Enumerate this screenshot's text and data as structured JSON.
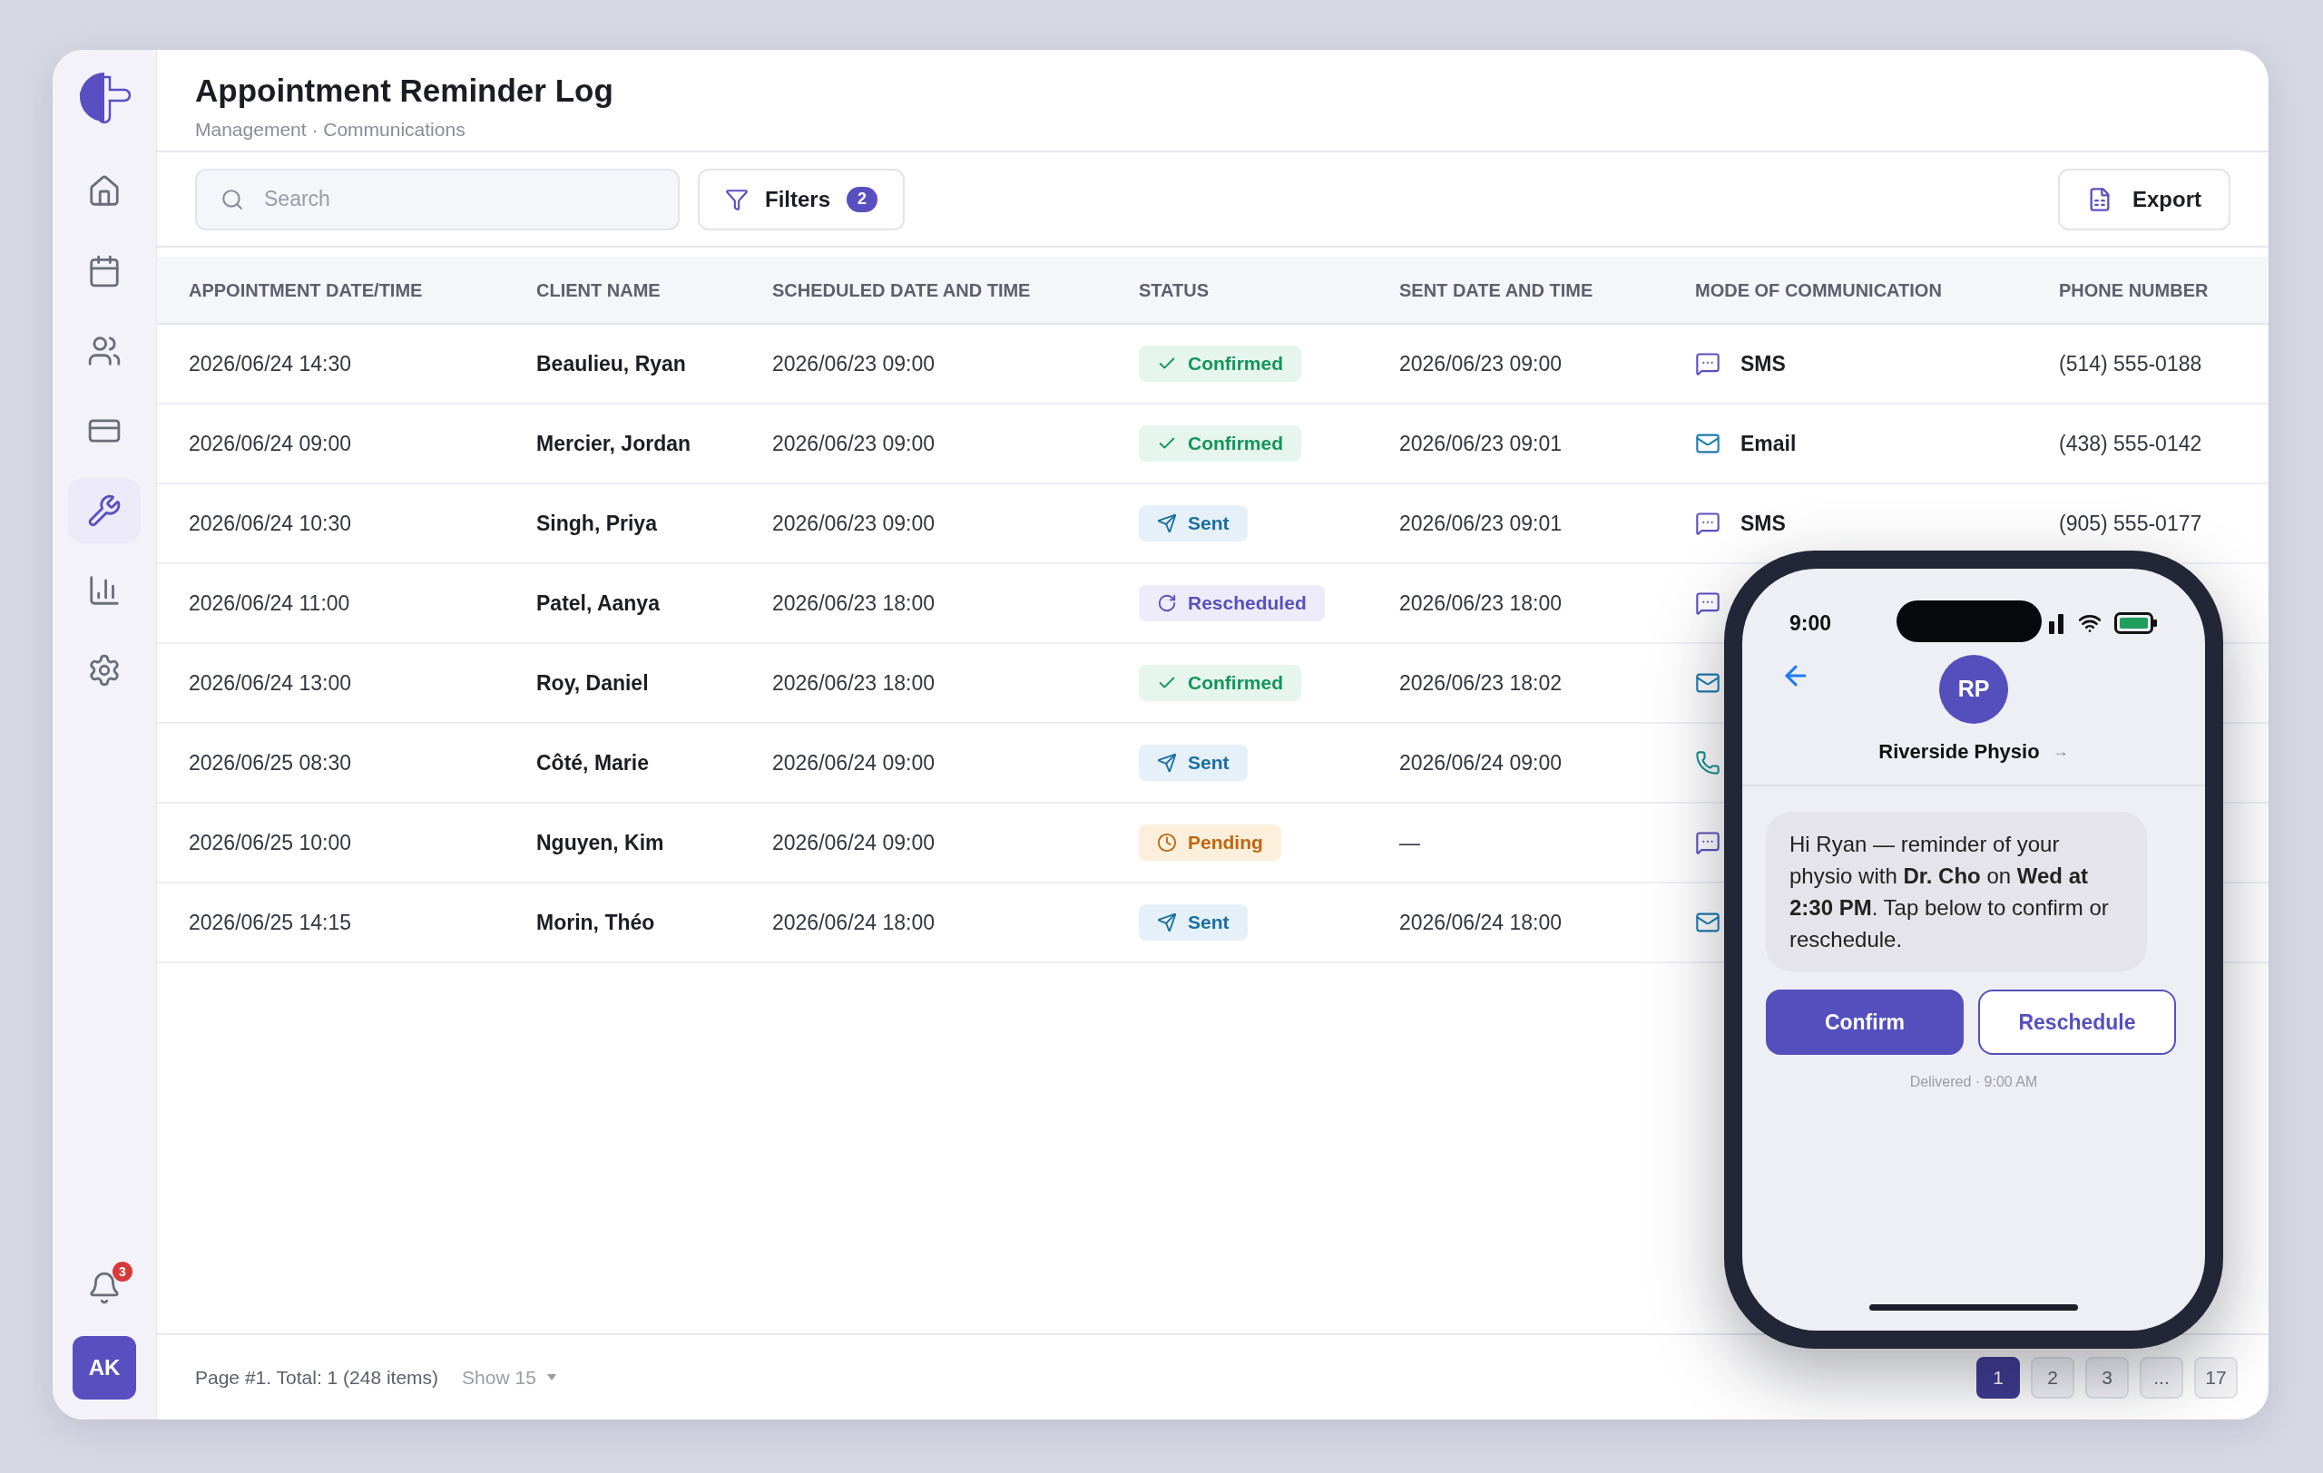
{
  "sidebar": {
    "items": [
      {
        "kind": "home",
        "selected": false
      },
      {
        "kind": "calendar",
        "selected": false
      },
      {
        "kind": "users",
        "selected": false
      },
      {
        "kind": "card",
        "selected": false
      },
      {
        "kind": "tools",
        "selected": true
      },
      {
        "kind": "chart",
        "selected": false
      },
      {
        "kind": "settings",
        "selected": false
      }
    ],
    "notifications": "3",
    "avatar": "AK"
  },
  "header": {
    "title": "Appointment Reminder Log",
    "breadcrumb": "Management · Communications"
  },
  "toolbar": {
    "search": {
      "placeholder": "Search"
    },
    "filters": {
      "label": "Filters",
      "count": "2"
    },
    "export": {
      "label": "Export"
    }
  },
  "table": {
    "columns": [
      "APPOINTMENT DATE/TIME",
      "CLIENT NAME",
      "SCHEDULED DATE AND TIME",
      "STATUS",
      "SENT DATE AND TIME",
      "MODE OF COMMUNICATION",
      "PHONE NUMBER"
    ],
    "rows": [
      {
        "appointment": "2026/06/24 14:30",
        "client": "Beaulieu, Ryan",
        "scheduled": "2026/06/23 09:00",
        "status": {
          "kind": "confirmed",
          "label": "Confirmed"
        },
        "sent": "2026/06/23 09:00",
        "mode": {
          "kind": "sms",
          "label": "SMS"
        },
        "phone": "(514) 555-0188"
      },
      {
        "appointment": "2026/06/24 09:00",
        "client": "Mercier, Jordan",
        "scheduled": "2026/06/23 09:00",
        "status": {
          "kind": "confirmed",
          "label": "Confirmed"
        },
        "sent": "2026/06/23 09:01",
        "mode": {
          "kind": "email",
          "label": "Email"
        },
        "phone": "(438) 555-0142"
      },
      {
        "appointment": "2026/06/24 10:30",
        "client": "Singh, Priya",
        "scheduled": "2026/06/23 09:00",
        "status": {
          "kind": "sent",
          "label": "Sent"
        },
        "sent": "2026/06/23 09:01",
        "mode": {
          "kind": "sms",
          "label": "SMS"
        },
        "phone": "(905) 555-0177"
      },
      {
        "appointment": "2026/06/24 11:00",
        "client": "Patel, Aanya",
        "scheduled": "2026/06/23 18:00",
        "status": {
          "kind": "rescheduled",
          "label": "Rescheduled"
        },
        "sent": "2026/06/23 18:00",
        "mode": {
          "kind": "sms"
        }
      },
      {
        "appointment": "2026/06/24 13:00",
        "client": "Roy, Daniel",
        "scheduled": "2026/06/23 18:00",
        "status": {
          "kind": "confirmed",
          "label": "Confirmed"
        },
        "sent": "2026/06/23 18:02",
        "mode": {
          "kind": "email"
        }
      },
      {
        "appointment": "2026/06/25 08:30",
        "client": "Côté, Marie",
        "scheduled": "2026/06/24 09:00",
        "status": {
          "kind": "sent",
          "label": "Sent"
        },
        "sent": "2026/06/24 09:00",
        "mode": {
          "kind": "call"
        }
      },
      {
        "appointment": "2026/06/25 10:00",
        "client": "Nguyen, Kim",
        "scheduled": "2026/06/24 09:00",
        "status": {
          "kind": "pending",
          "label": "Pending"
        },
        "sent": "—",
        "mode": {
          "kind": "sms"
        }
      },
      {
        "appointment": "2026/06/25 14:15",
        "client": "Morin, Théo",
        "scheduled": "2026/06/24 18:00",
        "status": {
          "kind": "sent",
          "label": "Sent"
        },
        "sent": "2026/06/24 18:00",
        "mode": {
          "kind": "email"
        }
      }
    ]
  },
  "footer": {
    "summary": "Page #1. Total: 1 (248 items)",
    "page_size": "Show 15",
    "pages": [
      {
        "label": "1",
        "selected": true
      },
      {
        "label": "2",
        "selected": false
      },
      {
        "label": "3",
        "selected": false
      },
      {
        "label": "...",
        "selected": false
      },
      {
        "label": "17",
        "selected": false
      }
    ]
  },
  "phone": {
    "time": "9:00",
    "avatar": "RP",
    "contact": "Riverside Physio",
    "contact_arrow": "→",
    "message": "Hi Ryan — reminder of your physio with **Dr. Cho** on **Wed at 2:30 PM**. Tap below to confirm or reschedule.",
    "buttons": [
      {
        "kind": "primary",
        "label": "Confirm"
      },
      {
        "kind": "secondary",
        "label": "Reschedule"
      }
    ],
    "delivery": "Delivered · 9:00 AM"
  }
}
